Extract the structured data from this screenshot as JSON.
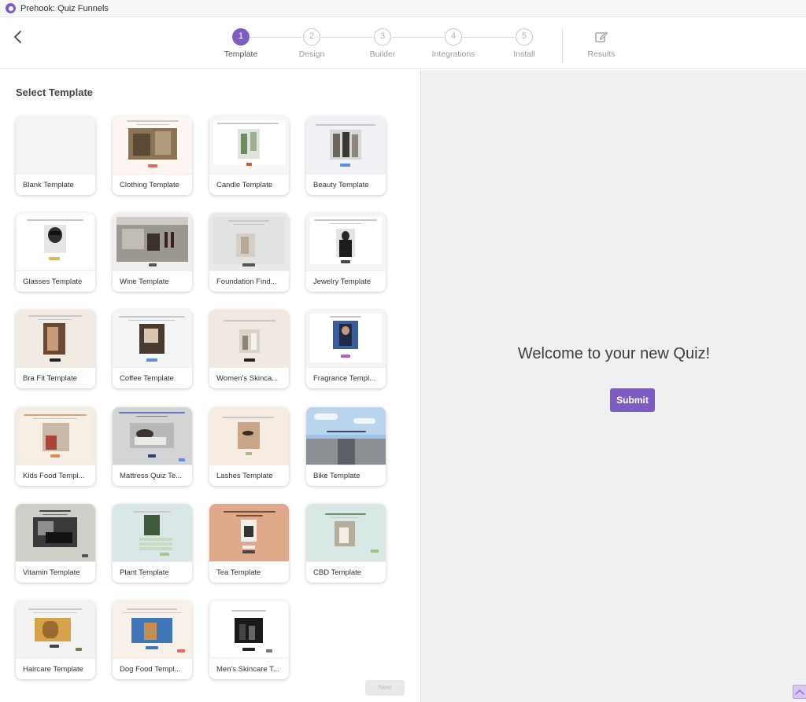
{
  "app": {
    "title": "Prehook: Quiz Funnels"
  },
  "colors": {
    "accent": "#7d5cc4"
  },
  "steps": [
    {
      "number": "1",
      "label": "Template",
      "active": true
    },
    {
      "number": "2",
      "label": "Design",
      "active": false
    },
    {
      "number": "3",
      "label": "Builder",
      "active": false
    },
    {
      "number": "4",
      "label": "Integrations",
      "active": false
    },
    {
      "number": "5",
      "label": "Install",
      "active": false
    }
  ],
  "results": {
    "label": "Results",
    "icon": "edit-icon"
  },
  "left_panel": {
    "title": "Select Template",
    "next_label": "Next",
    "templates": [
      {
        "name": "Blank Template"
      },
      {
        "name": "Clothing Template"
      },
      {
        "name": "Candle Template"
      },
      {
        "name": "Beauty Template"
      },
      {
        "name": "Glasses Template"
      },
      {
        "name": "Wine Template"
      },
      {
        "name": "Foundation Find..."
      },
      {
        "name": "Jewelry Template"
      },
      {
        "name": "Bra Fit Template"
      },
      {
        "name": "Coffee Template"
      },
      {
        "name": "Women's Skinca..."
      },
      {
        "name": "Fragrance Templ..."
      },
      {
        "name": "Kids Food Templ..."
      },
      {
        "name": "Mattress Quiz Te..."
      },
      {
        "name": "Lashes Template"
      },
      {
        "name": "Bike Template"
      },
      {
        "name": "Vitamin Template"
      },
      {
        "name": "Plant Template"
      },
      {
        "name": "Tea Template"
      },
      {
        "name": "CBD Template"
      },
      {
        "name": "Haircare Template"
      },
      {
        "name": "Dog Food Templ..."
      },
      {
        "name": "Men's Skincare T..."
      }
    ]
  },
  "preview": {
    "heading": "Welcome to your new Quiz!",
    "submit_label": "Submit"
  }
}
